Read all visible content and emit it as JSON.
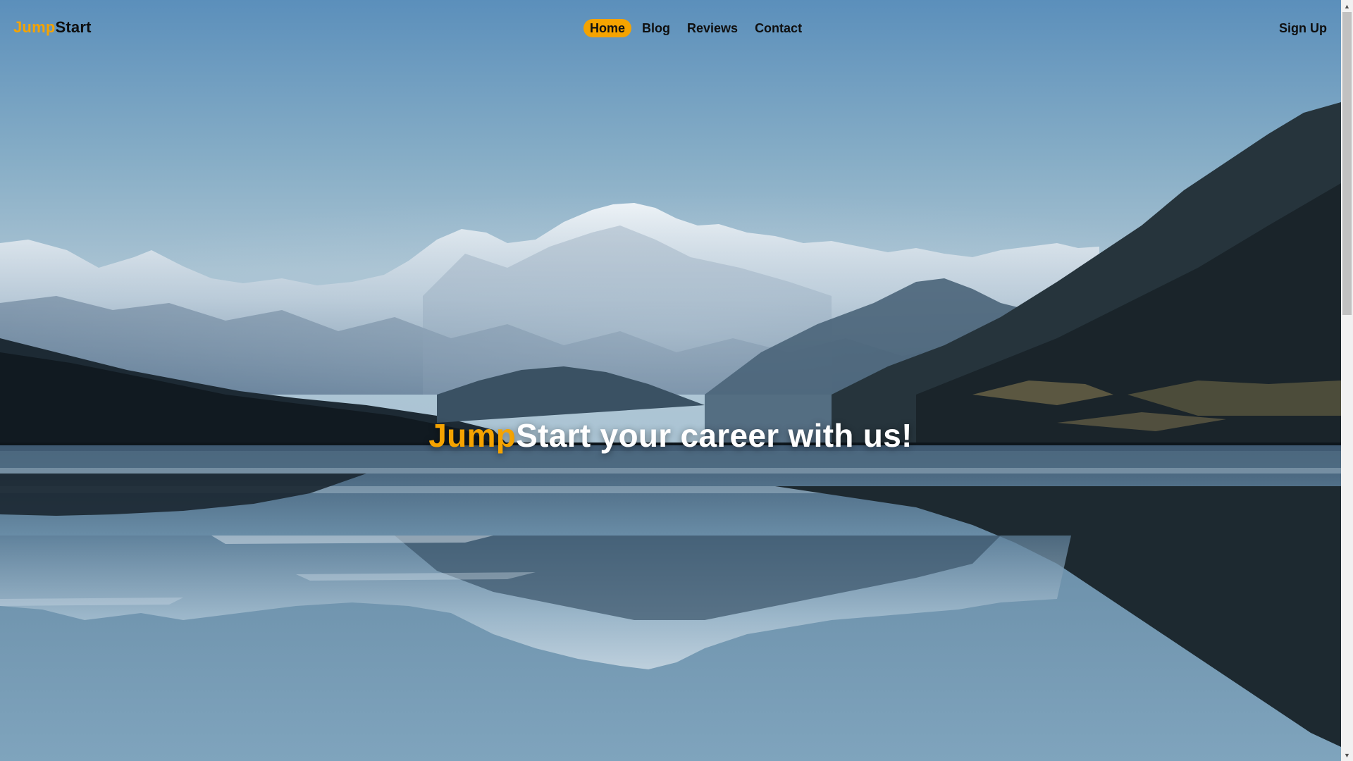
{
  "brand": {
    "accent": "Jump",
    "rest": "Start"
  },
  "nav": {
    "links": [
      {
        "label": "Home",
        "active": true
      },
      {
        "label": "Blog",
        "active": false
      },
      {
        "label": "Reviews",
        "active": false
      },
      {
        "label": "Contact",
        "active": false
      }
    ],
    "signup_label": "Sign Up"
  },
  "hero": {
    "headline_accent": "Jump",
    "headline_rest": "Start your career with us!"
  },
  "colors": {
    "accent": "#f5a300",
    "text_dark": "#0f0f0f",
    "headline": "#ffffff"
  },
  "scrollbar": {
    "up_icon": "triangle-up-icon",
    "down_icon": "triangle-down-icon"
  }
}
